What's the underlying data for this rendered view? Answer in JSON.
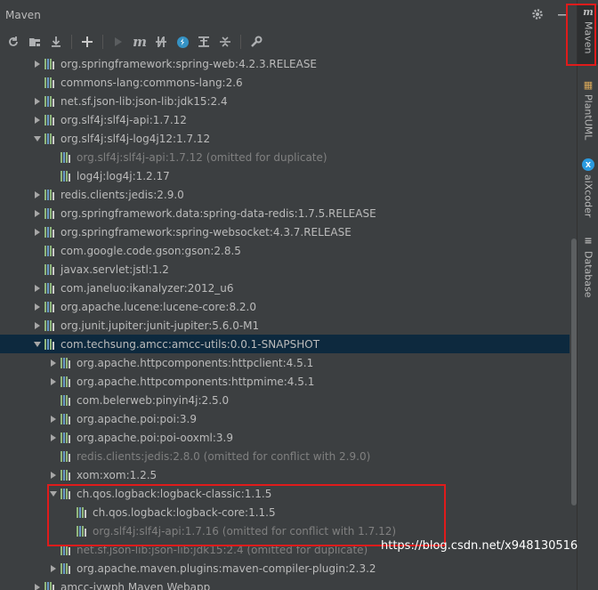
{
  "panel": {
    "title": "Maven"
  },
  "toolbar": {
    "buttons": [
      {
        "name": "reload-icon",
        "glyph": "⟳"
      },
      {
        "name": "add-folder-icon",
        "glyph": "▣"
      },
      {
        "name": "download-icon",
        "glyph": "⤓"
      },
      {
        "name": "plus-icon",
        "glyph": "+"
      },
      {
        "name": "run-icon",
        "glyph": "▶"
      },
      {
        "name": "maven-goal-icon",
        "glyph": "m"
      },
      {
        "name": "toggle-offline-icon",
        "glyph": "⫲"
      },
      {
        "name": "skip-tests-icon",
        "glyph": "↯"
      },
      {
        "name": "show-dependencies-icon",
        "glyph": "⊤"
      },
      {
        "name": "collapse-all-icon",
        "glyph": "⊥"
      },
      {
        "name": "settings-wrench-icon",
        "glyph": "🔧"
      }
    ]
  },
  "tree": {
    "rows": [
      {
        "arrow": "right",
        "indent": 0,
        "label": "org.springframework:spring-web:4.2.3.RELEASE",
        "dim": false
      },
      {
        "arrow": "none",
        "indent": 0,
        "label": "commons-lang:commons-lang:2.6",
        "dim": false
      },
      {
        "arrow": "right",
        "indent": 0,
        "label": "net.sf.json-lib:json-lib:jdk15:2.4",
        "dim": false
      },
      {
        "arrow": "right",
        "indent": 0,
        "label": "org.slf4j:slf4j-api:1.7.12",
        "dim": false
      },
      {
        "arrow": "down",
        "indent": 0,
        "label": "org.slf4j:slf4j-log4j12:1.7.12",
        "dim": false
      },
      {
        "arrow": "none",
        "indent": 1,
        "label": "org.slf4j:slf4j-api:1.7.12 (omitted for duplicate)",
        "dim": true
      },
      {
        "arrow": "none",
        "indent": 1,
        "label": "log4j:log4j:1.2.17",
        "dim": false
      },
      {
        "arrow": "right",
        "indent": 0,
        "label": "redis.clients:jedis:2.9.0",
        "dim": false
      },
      {
        "arrow": "right",
        "indent": 0,
        "label": "org.springframework.data:spring-data-redis:1.7.5.RELEASE",
        "dim": false
      },
      {
        "arrow": "right",
        "indent": 0,
        "label": "org.springframework:spring-websocket:4.3.7.RELEASE",
        "dim": false
      },
      {
        "arrow": "none",
        "indent": 0,
        "label": "com.google.code.gson:gson:2.8.5",
        "dim": false
      },
      {
        "arrow": "none",
        "indent": 0,
        "label": "javax.servlet:jstl:1.2",
        "dim": false
      },
      {
        "arrow": "right",
        "indent": 0,
        "label": "com.janeluo:ikanalyzer:2012_u6",
        "dim": false
      },
      {
        "arrow": "right",
        "indent": 0,
        "label": "org.apache.lucene:lucene-core:8.2.0",
        "dim": false
      },
      {
        "arrow": "right",
        "indent": 0,
        "label": "org.junit.jupiter:junit-jupiter:5.6.0-M1",
        "dim": false
      },
      {
        "arrow": "down",
        "indent": 0,
        "label": "com.techsung.amcc:amcc-utils:0.0.1-SNAPSHOT",
        "dim": false,
        "selected": true
      },
      {
        "arrow": "right",
        "indent": 1,
        "label": "org.apache.httpcomponents:httpclient:4.5.1",
        "dim": false
      },
      {
        "arrow": "right",
        "indent": 1,
        "label": "org.apache.httpcomponents:httpmime:4.5.1",
        "dim": false
      },
      {
        "arrow": "none",
        "indent": 1,
        "label": "com.belerweb:pinyin4j:2.5.0",
        "dim": false
      },
      {
        "arrow": "right",
        "indent": 1,
        "label": "org.apache.poi:poi:3.9",
        "dim": false
      },
      {
        "arrow": "right",
        "indent": 1,
        "label": "org.apache.poi:poi-ooxml:3.9",
        "dim": false
      },
      {
        "arrow": "none",
        "indent": 1,
        "label": "redis.clients:jedis:2.8.0 (omitted for conflict with 2.9.0)",
        "dim": true
      },
      {
        "arrow": "right",
        "indent": 1,
        "label": "xom:xom:1.2.5",
        "dim": false
      },
      {
        "arrow": "down",
        "indent": 1,
        "label": "ch.qos.logback:logback-classic:1.1.5",
        "dim": false
      },
      {
        "arrow": "none",
        "indent": 2,
        "label": "ch.qos.logback:logback-core:1.1.5",
        "dim": false
      },
      {
        "arrow": "none",
        "indent": 2,
        "label": "org.slf4j:slf4j-api:1.7.16 (omitted for conflict with 1.7.12)",
        "dim": true
      },
      {
        "arrow": "none",
        "indent": 1,
        "label": "net.sf.json-lib:json-lib:jdk15:2.4 (omitted for duplicate)",
        "dim": true
      },
      {
        "arrow": "right",
        "indent": 1,
        "label": "org.apache.maven.plugins:maven-compiler-plugin:2.3.2",
        "dim": false
      },
      {
        "arrow": "right",
        "indent": 0,
        "label": "amcc-jywph Maven Webapp",
        "dim": false
      }
    ]
  },
  "sidebar": {
    "tabs": [
      {
        "label": "Maven",
        "icon": "maven-icon",
        "glyph": "m",
        "color": "#bbbbbb"
      },
      {
        "label": "PlantUML",
        "icon": "plantuml-icon",
        "glyph": "▦",
        "color": "#d8a85a"
      },
      {
        "label": "aiXcoder",
        "icon": "aixcoder-icon",
        "glyph": "X",
        "color": "#2b9be0"
      },
      {
        "label": "Database",
        "icon": "database-icon",
        "glyph": "≡",
        "color": "#bbbbbb"
      }
    ]
  },
  "watermark": "https://blog.csdn.net/x948130516",
  "colors": {
    "background": "#3c3f41",
    "selection": "#0d293e",
    "highlight_box": "#e01b1b",
    "text": "#bbbbbb",
    "text_dim": "#808080"
  }
}
